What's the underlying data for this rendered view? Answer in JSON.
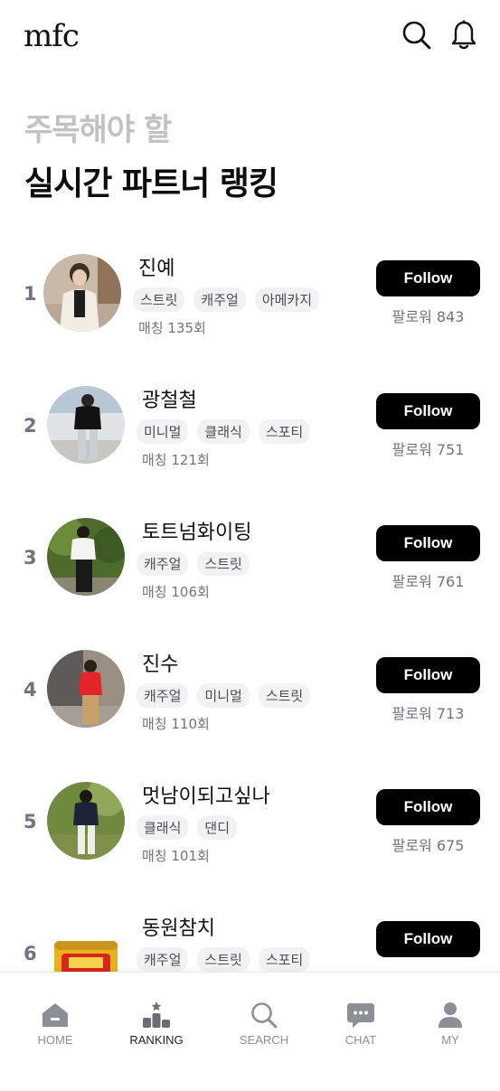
{
  "header": {
    "logo": "mfc",
    "icons": [
      "search-icon",
      "bell-icon"
    ]
  },
  "heading": {
    "subtitle": "주목해야 할",
    "title": "실시간 파트너 랭킹"
  },
  "ranking": [
    {
      "rank": "1",
      "name": "진예",
      "tags": [
        "스트릿",
        "캐주얼",
        "아메카지"
      ],
      "matches": "매칭 135회",
      "follow_label": "Follow",
      "followers": "팔로워 843"
    },
    {
      "rank": "2",
      "name": "광철철",
      "tags": [
        "미니멀",
        "클래식",
        "스포티"
      ],
      "matches": "매칭 121회",
      "follow_label": "Follow",
      "followers": "팔로워 751"
    },
    {
      "rank": "3",
      "name": "토트넘화이팅",
      "tags": [
        "캐주얼",
        "스트릿"
      ],
      "matches": "매칭 106회",
      "follow_label": "Follow",
      "followers": "팔로워 761"
    },
    {
      "rank": "4",
      "name": "진수",
      "tags": [
        "캐주얼",
        "미니멀",
        "스트릿"
      ],
      "matches": "매칭 110회",
      "follow_label": "Follow",
      "followers": "팔로워 713"
    },
    {
      "rank": "5",
      "name": "멋남이되고싶나",
      "tags": [
        "클래식",
        "댄디"
      ],
      "matches": "매칭 101회",
      "follow_label": "Follow",
      "followers": "팔로워 675"
    },
    {
      "rank": "6",
      "name": "동원참치",
      "tags": [
        "캐주얼",
        "스트릿",
        "스포티"
      ],
      "matches": "",
      "follow_label": "Follow",
      "followers": ""
    }
  ],
  "tabbar": {
    "active": "RANKING",
    "tabs": [
      {
        "label": "HOME",
        "icon": "home-icon"
      },
      {
        "label": "RANKING",
        "icon": "podium-icon"
      },
      {
        "label": "SEARCH",
        "icon": "search-icon"
      },
      {
        "label": "CHAT",
        "icon": "chat-icon"
      },
      {
        "label": "MY",
        "icon": "person-icon"
      }
    ]
  },
  "colors": {
    "primary": "#000000",
    "subtitle": "#c2c2c2",
    "rank": "#6f7480",
    "tag_bg": "#f1f2f4",
    "muted": "#707480",
    "tab_inactive": "#8c8f95"
  }
}
